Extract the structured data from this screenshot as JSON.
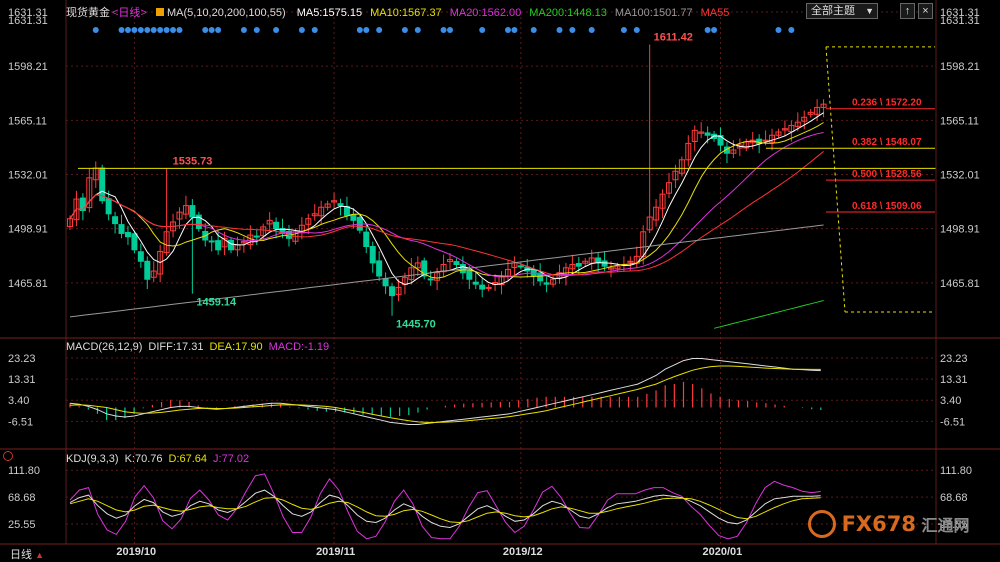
{
  "header": {
    "instrument": "现货黄金",
    "period": "<日线>",
    "ma_spec": "MA(5,10,20,200,100,55)",
    "ma_items": [
      {
        "label": "MA5:1575.15",
        "color": "#ffffff"
      },
      {
        "label": "MA10:1567.37",
        "color": "#e8e000"
      },
      {
        "label": "MA20:1562.00",
        "color": "#dd33dd"
      },
      {
        "label": "MA200:1448.13",
        "color": "#22cc22"
      },
      {
        "label": "MA100:1501.77",
        "color": "#999999"
      },
      {
        "label": "MA55",
        "color": "#ff3333"
      }
    ],
    "theme_button": "全部主题",
    "theme_arrow": "▼",
    "btn_up": "↑",
    "btn_close": "×"
  },
  "bottom_tab": {
    "label": "日线",
    "arrow": "▲"
  },
  "watermark": {
    "brand": "FX678",
    "cn": "汇通网"
  },
  "colors": {
    "up": "#ff3b3b",
    "down": "#00cc99",
    "grid": "#5a1a1a",
    "fib": "#ff2a2a",
    "yellow_line": "#e8e000"
  },
  "chart_data": [
    {
      "type": "candlestick",
      "title": "现货黄金 <日线>",
      "y_ticks": [
        1465.81,
        1498.91,
        1532.01,
        1565.11,
        1598.21,
        1631.31
      ],
      "ylim": [
        1432.71,
        1631.31
      ],
      "x_ticks": [
        "2019/10",
        "2019/11",
        "2019/12",
        "2020/01"
      ],
      "annotations": [
        {
          "text": "1611.42",
          "value": 1611.42
        },
        {
          "text": "1535.73",
          "value": 1535.73
        },
        {
          "text": "1459.14",
          "value": 1459.14
        },
        {
          "text": "1445.70",
          "value": 1445.7
        }
      ],
      "fib_levels": [
        {
          "label": "0.236 \\ 1572.20",
          "value": 1572.2
        },
        {
          "label": "0.382 \\ 1548.07",
          "value": 1548.07
        },
        {
          "label": "0.500 \\ 1528.56",
          "value": 1528.56
        },
        {
          "label": "0.618 \\ 1509.06",
          "value": 1509.06
        }
      ],
      "fib_range": [
        1448.0,
        1610.0
      ],
      "horizontal_line": 1535.73,
      "closes": [
        1505,
        1517,
        1510,
        1530,
        1536,
        1516,
        1508,
        1502,
        1496,
        1494,
        1486,
        1479,
        1468,
        1473,
        1485,
        1497,
        1503,
        1509,
        1513,
        1506,
        1499,
        1492,
        1491,
        1486,
        1493,
        1486,
        1489,
        1491,
        1495,
        1494,
        1500,
        1504,
        1499,
        1496,
        1493,
        1497,
        1501,
        1505,
        1508,
        1512,
        1514,
        1516,
        1513,
        1507,
        1504,
        1498,
        1488,
        1478,
        1470,
        1464,
        1458,
        1463,
        1469,
        1475,
        1478,
        1470,
        1468,
        1472,
        1477,
        1480,
        1477,
        1472,
        1468,
        1465,
        1462,
        1463,
        1466,
        1470,
        1474,
        1478,
        1476,
        1473,
        1470,
        1467,
        1465,
        1468,
        1472,
        1475,
        1477,
        1476,
        1479,
        1481,
        1478,
        1476,
        1475,
        1476,
        1477,
        1479,
        1482,
        1497,
        1506,
        1512,
        1520,
        1527,
        1534,
        1541,
        1551,
        1559,
        1558,
        1556,
        1554,
        1550,
        1545,
        1547,
        1550,
        1552,
        1553,
        1551,
        1553,
        1556,
        1558,
        1560,
        1562,
        1564,
        1567,
        1570,
        1573,
        1575
      ],
      "ma_series": [
        {
          "name": "MA5",
          "color": "#ffffff"
        },
        {
          "name": "MA10",
          "color": "#e8e000"
        },
        {
          "name": "MA20",
          "color": "#dd33dd"
        },
        {
          "name": "MA55",
          "color": "#ff3333"
        },
        {
          "name": "MA100",
          "color": "#999999"
        },
        {
          "name": "MA200",
          "color": "#22cc22"
        }
      ]
    },
    {
      "type": "bar",
      "title": "MACD(26,12,9)",
      "legend": [
        {
          "label": "MACD(26,12,9)",
          "color": "#dddddd"
        },
        {
          "label": "DIFF:17.31",
          "color": "#dddddd"
        },
        {
          "label": "DEA:17.90",
          "color": "#e8e000"
        },
        {
          "label": "MACD:-1.19",
          "color": "#dd33dd"
        }
      ],
      "y_ticks": [
        -6.51,
        3.4,
        13.31,
        23.23
      ],
      "ylim": [
        -12,
        27
      ],
      "diff": [
        2,
        1.5,
        0.5,
        -1,
        -3,
        -4,
        -4.5,
        -4,
        -3,
        -2,
        -1,
        0,
        0.5,
        0.5,
        0,
        -0.5,
        -0.8,
        -0.5,
        0,
        0.5,
        1,
        1.5,
        2,
        2,
        1.5,
        1,
        0.5,
        0,
        -0.5,
        -1,
        -2,
        -3,
        -4,
        -5,
        -6,
        -7,
        -7.5,
        -8,
        -8,
        -7.5,
        -7,
        -6.5,
        -6,
        -5.5,
        -5,
        -4.5,
        -4,
        -3.5,
        -3,
        -2,
        -1,
        0,
        1,
        2,
        3,
        4,
        5,
        6,
        7,
        8,
        9,
        10,
        11,
        13,
        15,
        18,
        20,
        22,
        23,
        23,
        22.5,
        22,
        21.5,
        21,
        20.5,
        20,
        19.5,
        19,
        18.5,
        18,
        17.8,
        17.5,
        17.3
      ],
      "dea": [
        1,
        1.2,
        1,
        0.5,
        0,
        -1,
        -2,
        -2.5,
        -2.8,
        -2.6,
        -2.3,
        -1.8,
        -1.2,
        -0.8,
        -0.5,
        -0.4,
        -0.5,
        -0.5,
        -0.3,
        0,
        0.3,
        0.6,
        0.9,
        1.2,
        1.3,
        1.2,
        1,
        0.8,
        0.5,
        0,
        -0.8,
        -1.5,
        -2.3,
        -3.2,
        -4,
        -4.8,
        -5.5,
        -6.2,
        -6.8,
        -7,
        -7,
        -6.9,
        -6.7,
        -6.4,
        -6,
        -5.6,
        -5.2,
        -4.8,
        -4.3,
        -3.7,
        -3,
        -2.3,
        -1.5,
        -0.5,
        0.5,
        1.5,
        2.5,
        3.5,
        4.5,
        5.5,
        6.5,
        7.5,
        8.5,
        9.8,
        11,
        12.8,
        14.5,
        16,
        17.5,
        18.5,
        19.2,
        19.5,
        19.5,
        19.3,
        19,
        18.8,
        18.5,
        18.3,
        18.1,
        18,
        17.95,
        17.9,
        17.9
      ]
    },
    {
      "type": "line",
      "title": "KDJ(9,3,3)",
      "legend": [
        {
          "label": "KDJ(9,3,3)",
          "color": "#dddddd"
        },
        {
          "label": "K:70.76",
          "color": "#dddddd"
        },
        {
          "label": "D:67.64",
          "color": "#e8e000"
        },
        {
          "label": "J:77.02",
          "color": "#dd33dd"
        }
      ],
      "y_ticks": [
        25.55,
        68.68,
        111.8
      ],
      "ylim": [
        0,
        125
      ],
      "k": [
        60,
        68,
        72,
        55,
        42,
        35,
        40,
        55,
        65,
        60,
        45,
        38,
        42,
        55,
        62,
        58,
        48,
        44,
        50,
        62,
        75,
        80,
        70,
        55,
        42,
        38,
        45,
        60,
        72,
        68,
        55,
        40,
        30,
        28,
        35,
        48,
        58,
        52,
        38,
        28,
        22,
        20,
        26,
        38,
        50,
        55,
        48,
        38,
        30,
        32,
        42,
        55,
        62,
        58,
        48,
        38,
        35,
        42,
        52,
        58,
        60,
        62,
        66,
        70,
        72,
        70,
        68,
        62,
        55,
        45,
        35,
        28,
        26,
        32,
        45,
        58,
        66,
        68,
        70,
        70,
        70,
        71
      ],
      "d": [
        58,
        62,
        66,
        62,
        55,
        48,
        45,
        48,
        54,
        56,
        52,
        48,
        46,
        49,
        53,
        55,
        52,
        50,
        50,
        54,
        61,
        67,
        68,
        64,
        57,
        51,
        49,
        53,
        59,
        62,
        60,
        53,
        45,
        39,
        38,
        41,
        47,
        49,
        46,
        40,
        34,
        29,
        28,
        31,
        37,
        43,
        45,
        43,
        39,
        37,
        39,
        44,
        50,
        53,
        51,
        47,
        43,
        43,
        46,
        50,
        53,
        56,
        59,
        63,
        66,
        67,
        67,
        66,
        62,
        56,
        49,
        42,
        36,
        34,
        38,
        45,
        52,
        58,
        63,
        66,
        67,
        67.6
      ]
    }
  ]
}
